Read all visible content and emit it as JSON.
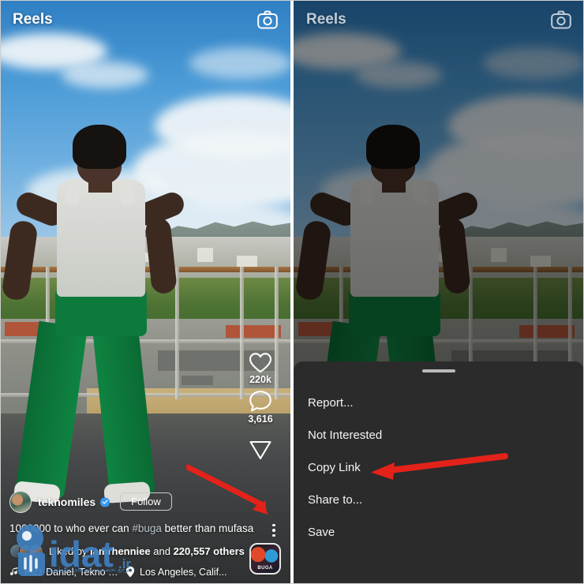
{
  "header": {
    "title": "Reels",
    "camera_icon": "camera-icon"
  },
  "post": {
    "username": "teknomiles",
    "verified": true,
    "follow_label": "Follow",
    "caption_main": "1000000 to who ever can ",
    "caption_hashtag": "#buga",
    "caption_tail": " better than mufasa",
    "liked_prefix": "Liked by ",
    "liked_user": "iamrhenniee",
    "liked_middle": " and ",
    "liked_count": "220,557 others",
    "audio": "Kizz Daniel, Tekno · Bu",
    "location": "Los Angeles, Calif...",
    "album_label": "BUGA"
  },
  "actions": {
    "like_icon": "heart-icon",
    "like_count": "220k",
    "comment_icon": "comment-icon",
    "comment_count": "3,616",
    "share_icon": "send-icon",
    "more_icon": "three-dot-menu-icon"
  },
  "sheet": {
    "handle": "drag-handle",
    "items": [
      {
        "label": "Report..."
      },
      {
        "label": "Not Interested"
      },
      {
        "label": "Copy Link"
      },
      {
        "label": "Share to..."
      },
      {
        "label": "Save"
      }
    ]
  },
  "annotation": {
    "arrow_color": "#e32219",
    "left_arrow_target": "three-dot-menu-icon",
    "right_arrow_target": "Copy Link"
  },
  "watermark": {
    "text": "gidat",
    "tld": ".ir",
    "subtitle": "مرجع تخصصی خبرهای تکنولوژی",
    "color": "#3f7fbf"
  }
}
